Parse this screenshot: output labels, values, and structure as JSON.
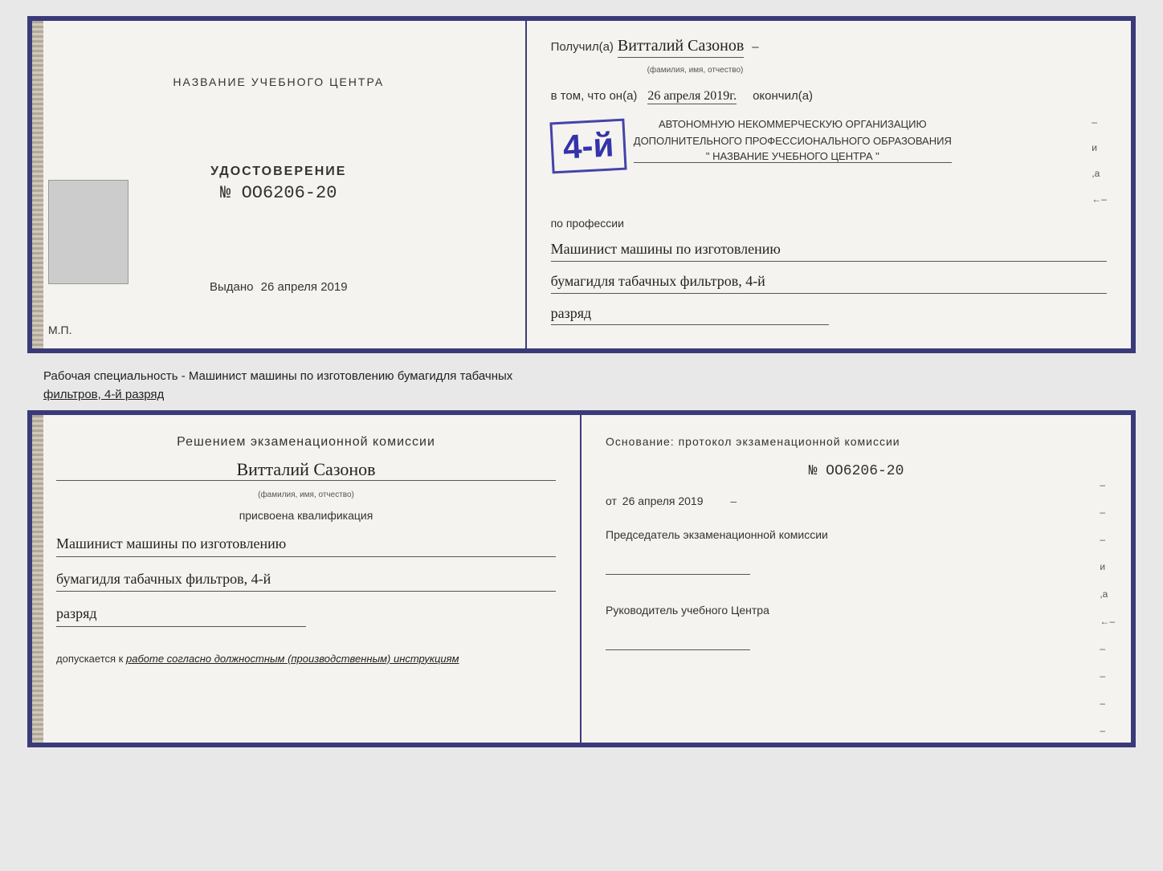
{
  "top_cert": {
    "left": {
      "school_name_label": "НАЗВАНИЕ УЧЕБНОГО ЦЕНТРА",
      "udost_label": "УДОСТОВЕРЕНИЕ",
      "udost_number": "№ OO6206-20",
      "vydano_prefix": "Выдано",
      "vydano_date": "26 апреля 2019",
      "mp_label": "М.П."
    },
    "right": {
      "poluchil_prefix": "Получил(а)",
      "recipient_name": "Витталий  Сазонов",
      "fio_note": "(фамилия, имя, отчество)",
      "dash": "–",
      "vtom_prefix": "в том, что он(а)",
      "vtom_date": "26 апреля 2019г.",
      "okonchil": "окончил(а)",
      "stamp_digit": "4-й",
      "org_line1": "АВТОНОМНУЮ НЕКОММЕРЧЕСКУЮ ОРГАНИЗАЦИЮ",
      "org_line2": "ДОПОЛНИТЕЛЬНОГО ПРОФЕССИОНАЛЬНОГО ОБРАЗОВАНИЯ",
      "org_name": "\" НАЗВАНИЕ УЧЕБНОГО ЦЕНТРА \"",
      "po_professii": "по профессии",
      "profession_line1": "Машинист машины по изготовлению",
      "profession_line2": "бумагидля табачных фильтров, 4-й",
      "profession_line3": "разряд"
    }
  },
  "middle": {
    "text": "Рабочая специальность - Машинист машины по изготовлению бумагидля табачных",
    "text2": "фильтров, 4-й разряд"
  },
  "bottom_cert": {
    "left": {
      "komissia_title": "Решением  экзаменационной  комиссии",
      "name": "Витталий  Сазонов",
      "fio_note": "(фамилия, имя, отчество)",
      "prisvoena": "присвоена квалификация",
      "kvaif_line1": "Машинист машины по изготовлению",
      "kvaif_line2": "бумагидля табачных фильтров, 4-й",
      "kvaif_line3": "разряд",
      "dopusk_prefix": "допускается к",
      "dopusk_text": "работе согласно должностным (производственным) инструкциям"
    },
    "right": {
      "osnovanie": "Основание: протокол экзаменационной  комиссии",
      "number": "№  OO6206-20",
      "ot_prefix": "от",
      "ot_date": "26 апреля 2019",
      "chairman_label": "Председатель экзаменационной комиссии",
      "rukovoditel_label": "Руководитель учебного Центра"
    }
  },
  "edge_labels": {
    "и": "и",
    "а": "а",
    "dash1": "←",
    "lines": [
      "–",
      "–",
      "–",
      "–",
      "–"
    ]
  }
}
